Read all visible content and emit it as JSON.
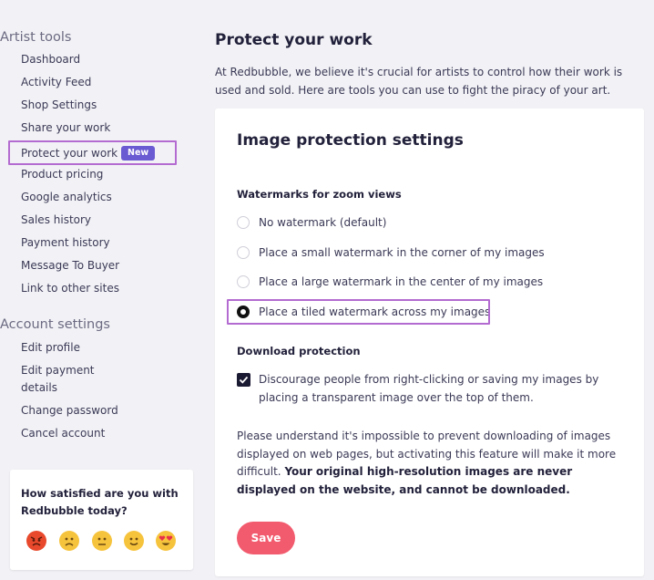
{
  "sidebar": {
    "artist_tools_heading": "Artist tools",
    "artist_items": [
      {
        "label": "Dashboard"
      },
      {
        "label": "Activity Feed"
      },
      {
        "label": "Shop Settings"
      },
      {
        "label": "Share your work"
      },
      {
        "label": "Protect your work",
        "badge": "New",
        "active": true
      },
      {
        "label": "Product pricing"
      },
      {
        "label": "Google analytics"
      },
      {
        "label": "Sales history"
      },
      {
        "label": "Payment history"
      },
      {
        "label": "Message To Buyer"
      },
      {
        "label": "Link to other sites"
      }
    ],
    "account_heading": "Account settings",
    "account_items": [
      {
        "label": "Edit profile"
      },
      {
        "label": "Edit payment details"
      },
      {
        "label": "Change password"
      },
      {
        "label": "Cancel account"
      }
    ]
  },
  "survey": {
    "question": "How satisfied are you with Redbubble today?",
    "faces": [
      "very-angry-face-icon",
      "frowning-face-icon",
      "neutral-face-icon",
      "slightly-smiling-face-icon",
      "heart-eyes-face-icon"
    ]
  },
  "main": {
    "title": "Protect your work",
    "intro": "At Redbubble, we believe it's crucial for artists to control how their work is used and sold. Here are tools you can use to fight the piracy of your art.",
    "card": {
      "title": "Image protection settings",
      "watermark_heading": "Watermarks for zoom views",
      "watermark_options": [
        {
          "label": "No watermark (default)",
          "checked": false
        },
        {
          "label": "Place a small watermark in the corner of my images",
          "checked": false
        },
        {
          "label": "Place a large watermark in the center of my images",
          "checked": false
        },
        {
          "label": "Place a tiled watermark across my images",
          "checked": true
        }
      ],
      "download_heading": "Download protection",
      "download_checkbox_label": "Discourage people from right-clicking or saving my images by placing a transparent image over the top of them.",
      "download_checked": true,
      "note_text": "Please understand it's impossible to prevent downloading of images displayed on web pages, but activating this feature will make it more difficult. ",
      "note_bold": "Your original high-resolution images are never displayed on the website, and cannot be downloaded.",
      "save_label": "Save"
    }
  },
  "colors": {
    "accent_purple": "#6b5bd2",
    "highlight_border": "#b46bd1",
    "save_button": "#f25a6d",
    "background": "#f2f2f6"
  }
}
